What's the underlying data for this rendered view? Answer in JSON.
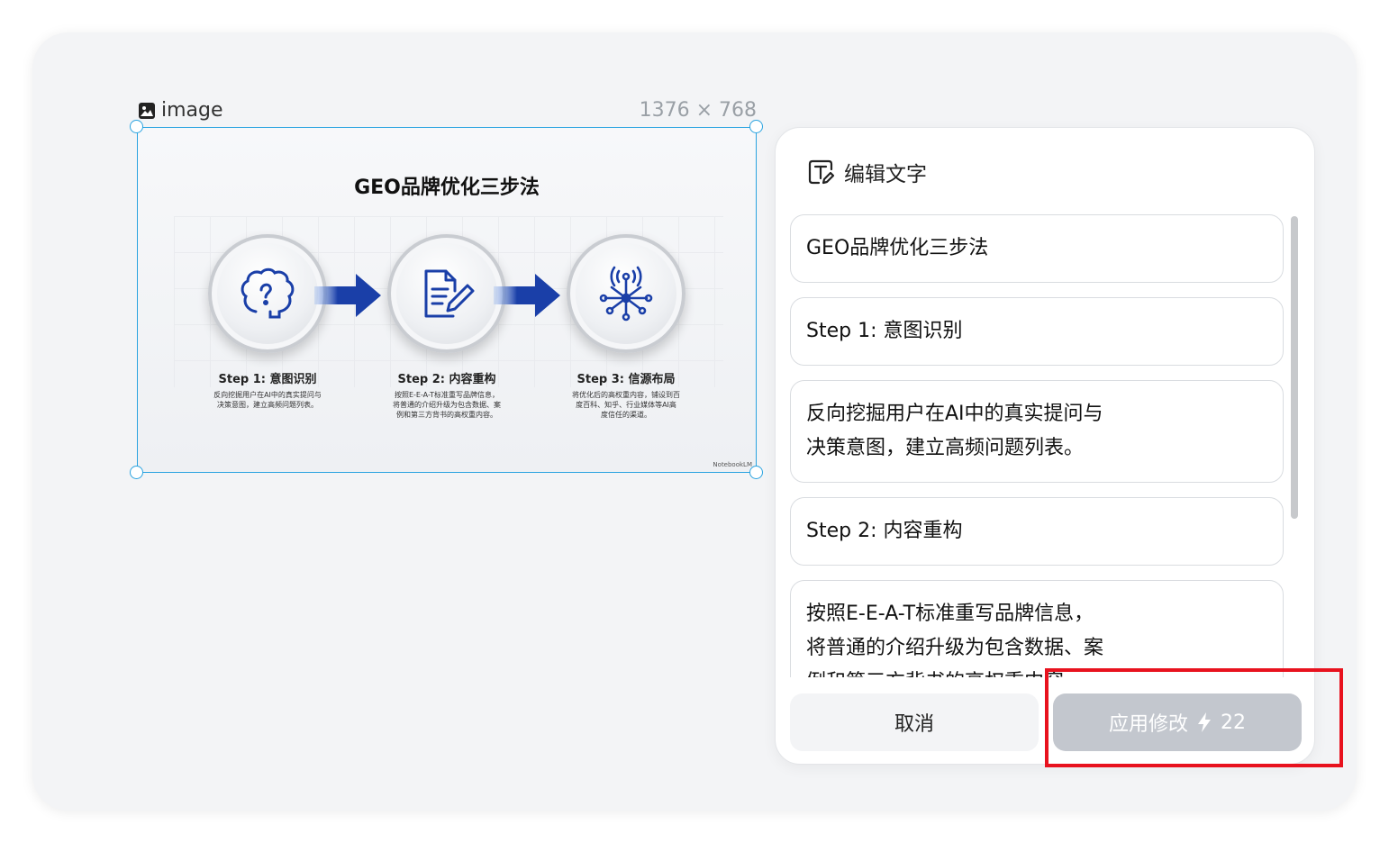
{
  "canvas": {
    "node_label": "image",
    "node_size": "1376 × 768",
    "slide": {
      "title": "GEO品牌优化三步法",
      "steps": [
        {
          "title": "Step 1:  意图识别",
          "desc_line1": "反向挖掘用户在AI中的真实提问与",
          "desc_line2": "决策意图，建立高频问题列表。",
          "desc_line3": ""
        },
        {
          "title": "Step 2:  内容重构",
          "desc_line1": "按照E-E-A-T标准重写品牌信息，",
          "desc_line2": "将普通的介绍升级为包含数据、案",
          "desc_line3": "例和第三方背书的高权重内容。"
        },
        {
          "title": "Step 3:  信源布局",
          "desc_line1": "将优化后的高权重内容，铺设到百",
          "desc_line2": "度百科、知乎、行业媒体等AI高",
          "desc_line3": "度信任的渠道。"
        }
      ],
      "watermark": "NotebookLM"
    }
  },
  "panel": {
    "header": "编辑文字",
    "fields": [
      {
        "line1": "GEO品牌优化三步法",
        "line2": "",
        "line3": ""
      },
      {
        "line1": "Step 1: 意图识别",
        "line2": "",
        "line3": ""
      },
      {
        "line1": "反向挖掘用户在AI中的真实提问与",
        "line2": "决策意图，建立高频问题列表。",
        "line3": ""
      },
      {
        "line1": "Step 2: 内容重构",
        "line2": "",
        "line3": ""
      },
      {
        "line1": "按照E-E-A-T标准重写品牌信息，",
        "line2": "将普通的介绍升级为包含数据、案",
        "line3": "例和第三方背书的高权重内容。"
      }
    ],
    "cancel_label": "取消",
    "apply_label": "应用修改",
    "apply_cost": "22"
  },
  "colors": {
    "selection": "#2aa3e0",
    "arrow_blue": "#1a3fa8",
    "apply_disabled": "#c3c7ce",
    "highlight_red": "#e8121e"
  },
  "icons": [
    "image-icon",
    "edit-text-icon",
    "brain-icon",
    "document-pen-icon",
    "network-icon",
    "lightning-icon"
  ]
}
